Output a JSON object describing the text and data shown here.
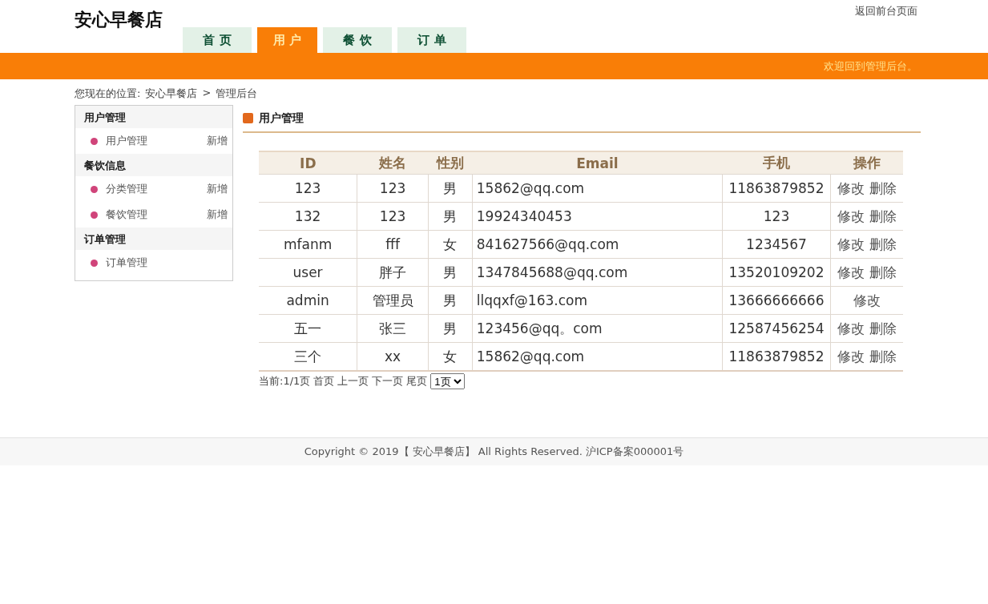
{
  "header": {
    "logo": "安心早餐店",
    "front_link": "返回前台页面",
    "nav": [
      {
        "label": "首 页",
        "selected": false
      },
      {
        "label": "用 户",
        "selected": true
      },
      {
        "label": "餐 饮",
        "selected": false
      },
      {
        "label": "订 单",
        "selected": false
      }
    ],
    "welcome": "欢迎回到管理后台。"
  },
  "breadcrumb": {
    "prefix": "您现在的位置:",
    "items": [
      "安心早餐店",
      "管理后台"
    ],
    "separator": ">"
  },
  "sidebar": {
    "groups": [
      {
        "title": "用户管理",
        "items": [
          {
            "label": "用户管理",
            "action": "新增"
          }
        ]
      },
      {
        "title": "餐饮信息",
        "items": [
          {
            "label": "分类管理",
            "action": "新增"
          },
          {
            "label": "餐饮管理",
            "action": "新增"
          }
        ]
      },
      {
        "title": "订单管理",
        "items": [
          {
            "label": "订单管理"
          }
        ]
      }
    ]
  },
  "main": {
    "title": "用户管理",
    "table": {
      "columns": [
        "ID",
        "姓名",
        "性别",
        "Email",
        "手机",
        "操作"
      ],
      "rows": [
        {
          "cells": [
            "123",
            "123",
            "男",
            "15862@qq.com",
            "11863879852"
          ],
          "actions": [
            "修改",
            "删除"
          ]
        },
        {
          "cells": [
            "132",
            "123",
            "男",
            "19924340453",
            "123"
          ],
          "actions": [
            "修改",
            "删除"
          ]
        },
        {
          "cells": [
            "mfanm",
            "fff",
            "女",
            "841627566@qq.com",
            "1234567"
          ],
          "actions": [
            "修改",
            "删除"
          ]
        },
        {
          "cells": [
            "user",
            "胖子",
            "男",
            "1347845688@qq.com",
            "13520109202"
          ],
          "actions": [
            "修改",
            "删除"
          ]
        },
        {
          "cells": [
            "admin",
            "管理员",
            "男",
            "llqqxf@163.com",
            "13666666666"
          ],
          "actions": [
            "修改"
          ]
        },
        {
          "cells": [
            "五一",
            "张三",
            "男",
            "123456@qq。com",
            "12587456254"
          ],
          "actions": [
            "修改",
            "删除"
          ]
        },
        {
          "cells": [
            "三个",
            "xx",
            "女",
            "15862@qq.com",
            "11863879852"
          ],
          "actions": [
            "修改",
            "删除"
          ]
        }
      ]
    },
    "pager": {
      "status": "当前:1/1页",
      "links": [
        "首页",
        "上一页",
        "下一页",
        "尾页"
      ],
      "select": "1页"
    }
  },
  "footer": "Copyright © 2019【 安心早餐店】 All Rights Reserved. 沪ICP备案000001号"
}
